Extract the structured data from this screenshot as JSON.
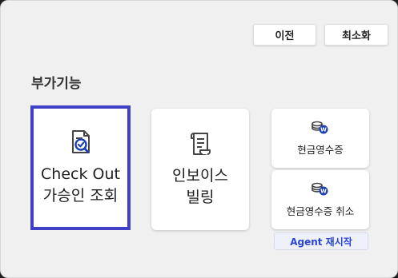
{
  "header": {
    "prev_label": "이전",
    "minimize_label": "최소화"
  },
  "section": {
    "title": "부가기능"
  },
  "tiles": {
    "checkout": {
      "line1": "Check Out",
      "line2": "가승인 조회",
      "icon": "document-search-icon"
    },
    "invoice": {
      "line1": "인보이스",
      "line2": "빌링",
      "icon": "scroll-document-icon"
    },
    "cash_receipt": {
      "label": "현금영수증",
      "icon": "coins-won-icon"
    },
    "cash_receipt_cancel": {
      "label": "현금영수증 취소",
      "icon": "coins-won-icon"
    }
  },
  "agent": {
    "label": "Agent 재시작"
  },
  "colors": {
    "accent_border": "#3f3fc8",
    "agent_text": "#2a44d6",
    "icon_blue": "#1e3fae"
  }
}
